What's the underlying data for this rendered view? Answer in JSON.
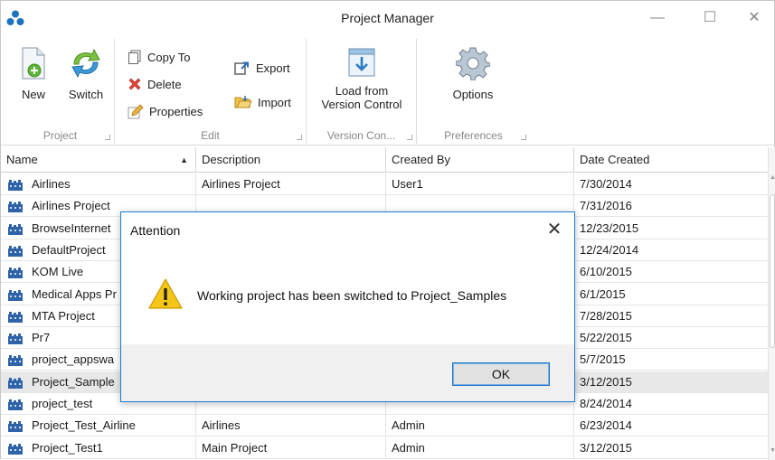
{
  "window": {
    "title": "Project Manager",
    "controls": {
      "minimize": "—",
      "maximize": "☐",
      "close": "✕"
    }
  },
  "ribbon": {
    "groups": [
      {
        "label": "Project",
        "buttons": [
          {
            "label": "New",
            "icon": "new-document-icon"
          },
          {
            "label": "Switch",
            "icon": "switch-arrows-icon"
          }
        ]
      },
      {
        "label": "Edit",
        "buttons": [
          {
            "label": "Copy To",
            "icon": "copy-icon"
          },
          {
            "label": "Delete",
            "icon": "delete-x-icon"
          },
          {
            "label": "Properties",
            "icon": "properties-pencil-icon"
          },
          {
            "label": "Export",
            "icon": "export-icon"
          },
          {
            "label": "Import",
            "icon": "import-folder-icon"
          }
        ]
      },
      {
        "label": "Version Con...",
        "buttons": [
          {
            "label_line1": "Load from",
            "label_line2": "Version Control",
            "icon": "load-version-control-icon"
          }
        ]
      },
      {
        "label": "Preferences",
        "buttons": [
          {
            "label": "Options",
            "icon": "gear-icon"
          }
        ]
      }
    ]
  },
  "grid": {
    "columns": [
      "Name",
      "Description",
      "Created By",
      "Date Created"
    ],
    "sort_indicator": "▲",
    "rows": [
      {
        "name": "Airlines",
        "description": "Airlines Project",
        "created_by": "User1",
        "date": "7/30/2014"
      },
      {
        "name": "Airlines Project",
        "description": "",
        "created_by": "",
        "date": "7/31/2016"
      },
      {
        "name": "BrowseInternet",
        "description": "",
        "created_by": "",
        "date": "12/23/2015"
      },
      {
        "name": "DefaultProject",
        "description": "",
        "created_by": "",
        "date": "12/24/2014"
      },
      {
        "name": "KOM Live",
        "description": "",
        "created_by": "",
        "date": "6/10/2015"
      },
      {
        "name": "Medical Apps Pr",
        "description": "",
        "created_by": "",
        "date": "6/1/2015"
      },
      {
        "name": "MTA Project",
        "description": "",
        "created_by": "",
        "date": "7/28/2015"
      },
      {
        "name": "Pr7",
        "description": "",
        "created_by": "",
        "date": "5/22/2015"
      },
      {
        "name": "project_appswa",
        "description": "",
        "created_by": "",
        "date": "5/7/2015"
      },
      {
        "name": "Project_Sample",
        "description": "",
        "created_by": "",
        "date": "3/12/2015"
      },
      {
        "name": "project_test",
        "description": "",
        "created_by": "",
        "date": "8/24/2014"
      },
      {
        "name": "Project_Test_Airline",
        "description": "Airlines",
        "created_by": "Admin",
        "date": "6/23/2014"
      },
      {
        "name": "Project_Test1",
        "description": "Main Project",
        "created_by": "Admin",
        "date": "3/12/2015"
      }
    ]
  },
  "dialog": {
    "title": "Attention",
    "close": "✕",
    "message": "Working project has been switched to Project_Samples",
    "ok_label": "OK"
  },
  "colors": {
    "accent": "#1d7ed1",
    "selected_row": "#e8e8e8",
    "warning": "#f5c518"
  }
}
